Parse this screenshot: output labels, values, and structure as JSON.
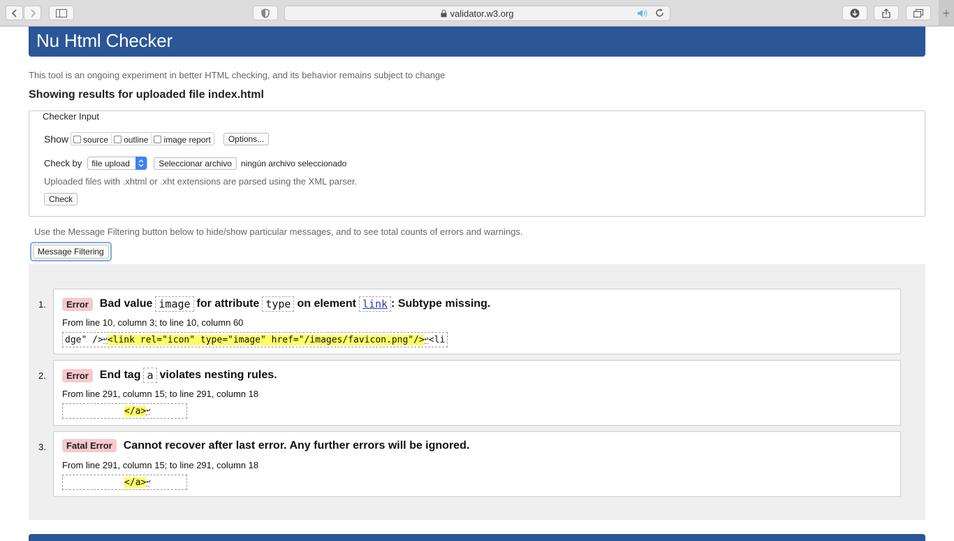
{
  "browser": {
    "url": "validator.w3.org"
  },
  "page": {
    "title": "Nu Html Checker",
    "intro": "This tool is an ongoing experiment in better HTML checking, and its behavior remains subject to change",
    "results_heading": "Showing results for uploaded file index.html",
    "checker_input": {
      "legend": "Checker Input",
      "show_label": "Show",
      "options": [
        "source",
        "outline",
        "image report"
      ],
      "options_button": "Options...",
      "check_by_label": "Check by",
      "check_by_value": "file upload",
      "file_button": "Seleccionar archivo",
      "file_status": "ningún archivo seleccionado",
      "note": "Uploaded files with .xhtml or .xht extensions are parsed using the XML parser.",
      "check_button": "Check"
    },
    "filter_hint": "Use the Message Filtering button below to hide/show particular messages, and to see total counts of errors and warnings.",
    "filter_button": "Message Filtering",
    "messages": [
      {
        "num": "1.",
        "type": "Error",
        "text_a": "Bad value",
        "code_a": "image",
        "text_b": "for attribute",
        "code_b": "type",
        "text_c": "on element",
        "code_c": "link",
        "text_d": ": Subtype missing.",
        "location": "From line 10, column 3; to line 10, column 60",
        "extract_pre": "dge\" />",
        "extract_hl": "<link rel=\"icon\" type=\"image\" href=\"/images/favicon.png\"/>",
        "extract_post": "<li"
      },
      {
        "num": "2.",
        "type": "Error",
        "text_a": "End tag",
        "code_a": "a",
        "text_b": "violates nesting rules.",
        "location": "From line 291, column 15; to line 291, column 18",
        "extract_hl": "</a>"
      },
      {
        "num": "3.",
        "type": "Fatal Error",
        "text_a": "Cannot recover after last error. Any further errors will be ignored.",
        "location": "From line 291, column 15; to line 291, column 18",
        "extract_hl": "</a>"
      }
    ]
  }
}
